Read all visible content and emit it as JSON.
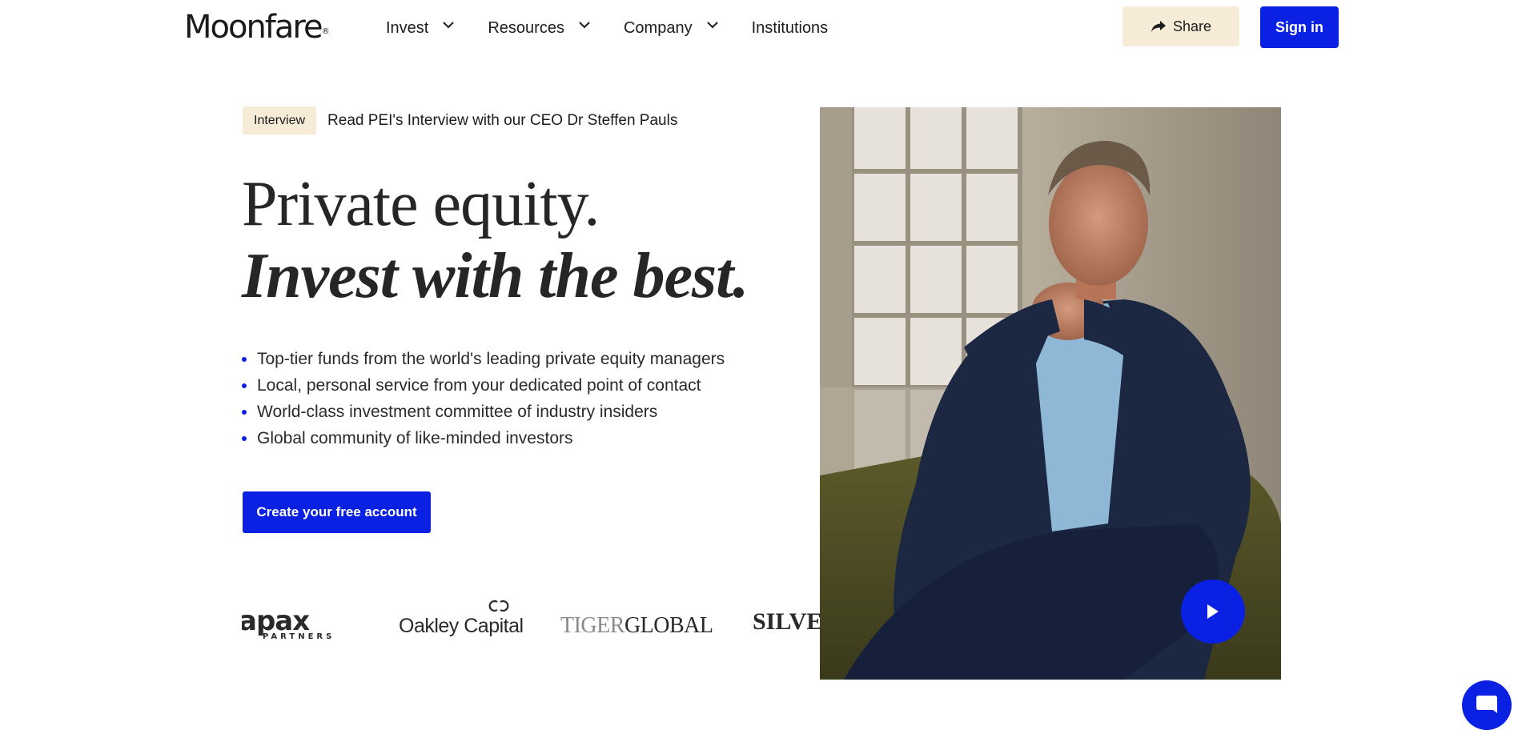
{
  "brand": {
    "name": "Moonfare",
    "registered": "®",
    "accent": "#0a20e3",
    "cream": "#f5ebd6"
  },
  "nav": {
    "items": [
      {
        "label": "Invest",
        "has_dropdown": true
      },
      {
        "label": "Resources",
        "has_dropdown": true
      },
      {
        "label": "Company",
        "has_dropdown": true
      },
      {
        "label": "Institutions",
        "has_dropdown": false
      }
    ],
    "share_label": "Share",
    "signin_label": "Sign in"
  },
  "announcement": {
    "badge": "Interview",
    "text": "Read PEI's Interview with our CEO Dr Steffen Pauls"
  },
  "hero": {
    "headline_line1": "Private equity.",
    "headline_line2": "Invest with the best.",
    "bullets": [
      "Top-tier funds from the world's leading private equity managers",
      "Local, personal service from your dedicated point of contact",
      "World-class investment committee of industry insiders",
      "Global community of like-minded investors"
    ],
    "cta_label": "Create your free account"
  },
  "partner_logos": {
    "apax": {
      "main": "apax",
      "sub": "PARTNERS"
    },
    "oakley": "Oakley Capital",
    "tiger": {
      "a": "TIGER",
      "b": "GLOBAL"
    },
    "silver": "SILVER"
  },
  "video": {
    "icon": "play-icon"
  },
  "chat": {
    "icon": "chat-bubble-icon"
  }
}
